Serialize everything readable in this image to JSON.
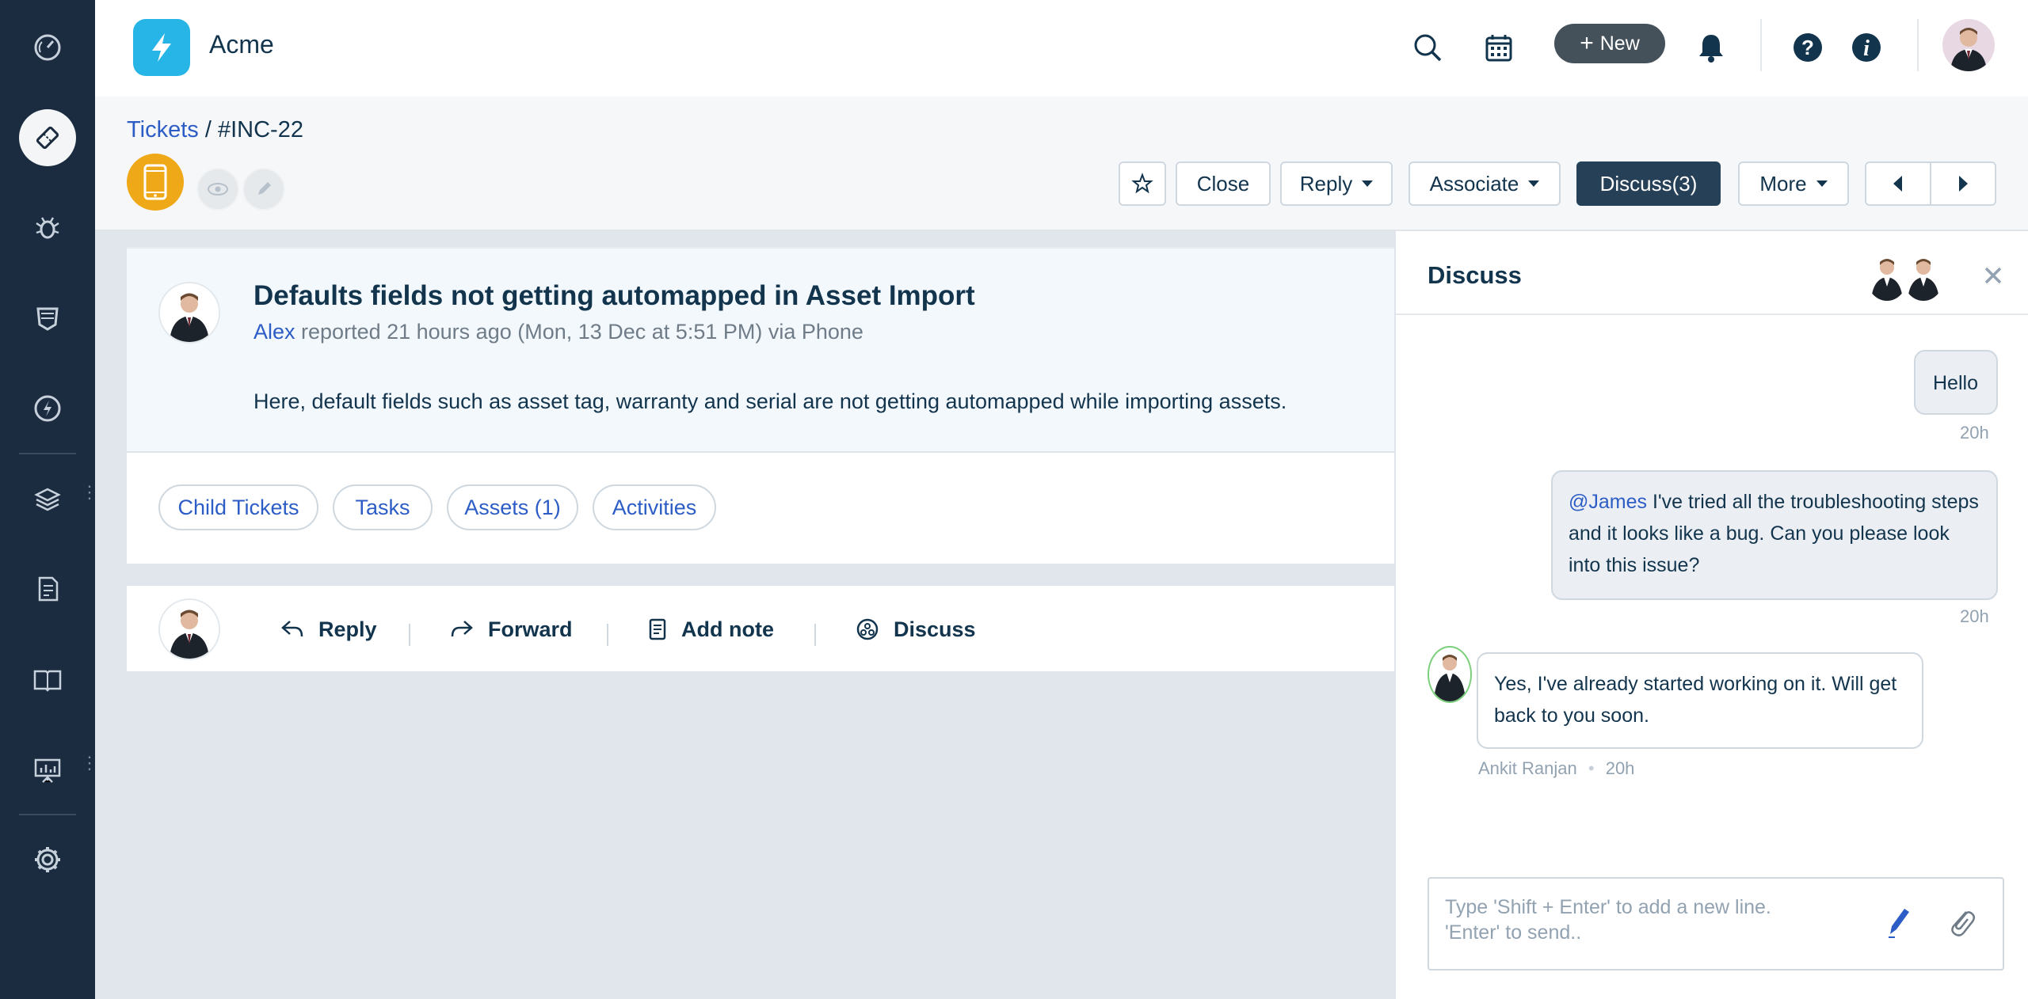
{
  "header": {
    "brand": "Acme",
    "new_button": "New"
  },
  "breadcrumb": {
    "root": "Tickets",
    "separator": "/",
    "current": "#INC-22"
  },
  "toolbar": {
    "close_label": "Close",
    "reply_label": "Reply",
    "associate_label": "Associate",
    "discuss_label": "Discuss(3)",
    "more_label": "More"
  },
  "ticket": {
    "title": "Defaults fields not getting automapped in Asset Import",
    "author": "Alex",
    "meta_text": " reported 21 hours ago (Mon, 13 Dec at 5:51 PM) via Phone",
    "description": "Here, default fields such as asset tag, warranty and serial are not getting automapped while importing assets."
  },
  "tabs": [
    {
      "label": "Child Tickets"
    },
    {
      "label": "Tasks"
    },
    {
      "label": "Assets (1)"
    },
    {
      "label": "Activities"
    }
  ],
  "actions": {
    "reply": "Reply",
    "forward": "Forward",
    "add_note": "Add note",
    "discuss": "Discuss"
  },
  "discuss": {
    "title": "Discuss",
    "messages": [
      {
        "text": "Hello",
        "time": "20h"
      },
      {
        "mention": "@James",
        "text": " I've tried all the troubleshooting steps and it looks like a bug. Can you please look into this issue?",
        "time": "20h"
      },
      {
        "text": "Yes, I've already started working on it. Will get back to you soon.",
        "author": "Ankit Ranjan",
        "dot": "•",
        "time": "20h"
      }
    ],
    "composer_line1": "Type 'Shift + Enter' to add a new line.",
    "composer_line2": "'Enter' to send.."
  },
  "colors": {
    "sidebar_bg": "#1b2c40",
    "logo_bg": "#27b5e7",
    "discuss_btn_bg": "#264057",
    "link": "#2c5cc5",
    "channel_icon_bg": "#efa817"
  },
  "icons": {
    "sidebar": [
      "dashboard-icon",
      "tickets-icon",
      "problems-icon",
      "changes-icon",
      "releases-icon",
      "assets-icon",
      "contracts-icon",
      "solutions-icon",
      "reports-icon",
      "settings-icon"
    ],
    "header": [
      "search-icon",
      "calendar-icon",
      "plus-icon",
      "bell-icon",
      "help-icon",
      "info-icon"
    ]
  }
}
